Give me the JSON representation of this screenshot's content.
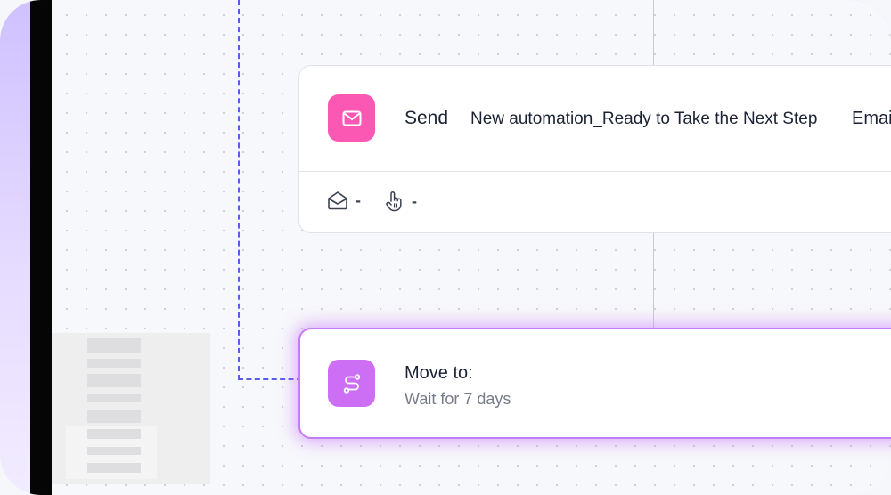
{
  "send_step": {
    "action_label": "Send",
    "email_name": "New automation_Ready to Take the Next Step",
    "type_label": "Emai",
    "opens_value": "-",
    "clicks_value": "-",
    "icon": "mail-icon",
    "icon_color": "#fb58b3"
  },
  "move_step": {
    "title": "Move to:",
    "subtitle": "Wait for 7 days",
    "icon": "route-icon",
    "icon_color": "#cc6ff5",
    "highlight_color": "#c57cf7"
  },
  "colors": {
    "connector_dashed": "#5b5bef",
    "connector_solid": "#c8cbd2",
    "canvas_background": "#f7f8fb"
  }
}
